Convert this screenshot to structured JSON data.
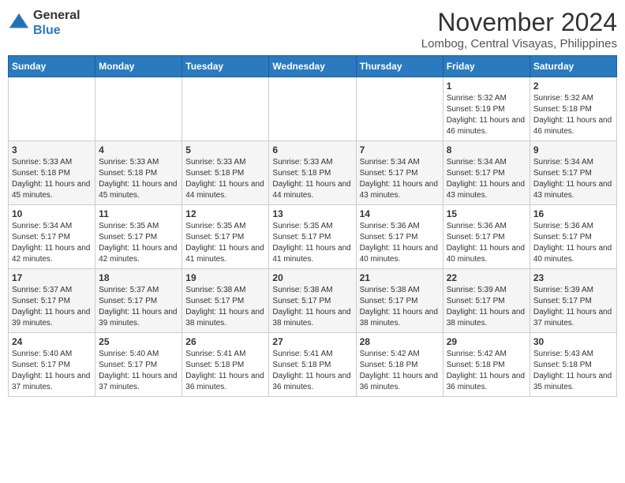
{
  "header": {
    "logo_line1": "General",
    "logo_line2": "Blue",
    "month": "November 2024",
    "location": "Lombog, Central Visayas, Philippines"
  },
  "weekdays": [
    "Sunday",
    "Monday",
    "Tuesday",
    "Wednesday",
    "Thursday",
    "Friday",
    "Saturday"
  ],
  "weeks": [
    [
      {
        "day": "",
        "info": ""
      },
      {
        "day": "",
        "info": ""
      },
      {
        "day": "",
        "info": ""
      },
      {
        "day": "",
        "info": ""
      },
      {
        "day": "",
        "info": ""
      },
      {
        "day": "1",
        "info": "Sunrise: 5:32 AM\nSunset: 5:19 PM\nDaylight: 11 hours and 46 minutes."
      },
      {
        "day": "2",
        "info": "Sunrise: 5:32 AM\nSunset: 5:18 PM\nDaylight: 11 hours and 46 minutes."
      }
    ],
    [
      {
        "day": "3",
        "info": "Sunrise: 5:33 AM\nSunset: 5:18 PM\nDaylight: 11 hours and 45 minutes."
      },
      {
        "day": "4",
        "info": "Sunrise: 5:33 AM\nSunset: 5:18 PM\nDaylight: 11 hours and 45 minutes."
      },
      {
        "day": "5",
        "info": "Sunrise: 5:33 AM\nSunset: 5:18 PM\nDaylight: 11 hours and 44 minutes."
      },
      {
        "day": "6",
        "info": "Sunrise: 5:33 AM\nSunset: 5:18 PM\nDaylight: 11 hours and 44 minutes."
      },
      {
        "day": "7",
        "info": "Sunrise: 5:34 AM\nSunset: 5:17 PM\nDaylight: 11 hours and 43 minutes."
      },
      {
        "day": "8",
        "info": "Sunrise: 5:34 AM\nSunset: 5:17 PM\nDaylight: 11 hours and 43 minutes."
      },
      {
        "day": "9",
        "info": "Sunrise: 5:34 AM\nSunset: 5:17 PM\nDaylight: 11 hours and 43 minutes."
      }
    ],
    [
      {
        "day": "10",
        "info": "Sunrise: 5:34 AM\nSunset: 5:17 PM\nDaylight: 11 hours and 42 minutes."
      },
      {
        "day": "11",
        "info": "Sunrise: 5:35 AM\nSunset: 5:17 PM\nDaylight: 11 hours and 42 minutes."
      },
      {
        "day": "12",
        "info": "Sunrise: 5:35 AM\nSunset: 5:17 PM\nDaylight: 11 hours and 41 minutes."
      },
      {
        "day": "13",
        "info": "Sunrise: 5:35 AM\nSunset: 5:17 PM\nDaylight: 11 hours and 41 minutes."
      },
      {
        "day": "14",
        "info": "Sunrise: 5:36 AM\nSunset: 5:17 PM\nDaylight: 11 hours and 40 minutes."
      },
      {
        "day": "15",
        "info": "Sunrise: 5:36 AM\nSunset: 5:17 PM\nDaylight: 11 hours and 40 minutes."
      },
      {
        "day": "16",
        "info": "Sunrise: 5:36 AM\nSunset: 5:17 PM\nDaylight: 11 hours and 40 minutes."
      }
    ],
    [
      {
        "day": "17",
        "info": "Sunrise: 5:37 AM\nSunset: 5:17 PM\nDaylight: 11 hours and 39 minutes."
      },
      {
        "day": "18",
        "info": "Sunrise: 5:37 AM\nSunset: 5:17 PM\nDaylight: 11 hours and 39 minutes."
      },
      {
        "day": "19",
        "info": "Sunrise: 5:38 AM\nSunset: 5:17 PM\nDaylight: 11 hours and 38 minutes."
      },
      {
        "day": "20",
        "info": "Sunrise: 5:38 AM\nSunset: 5:17 PM\nDaylight: 11 hours and 38 minutes."
      },
      {
        "day": "21",
        "info": "Sunrise: 5:38 AM\nSunset: 5:17 PM\nDaylight: 11 hours and 38 minutes."
      },
      {
        "day": "22",
        "info": "Sunrise: 5:39 AM\nSunset: 5:17 PM\nDaylight: 11 hours and 38 minutes."
      },
      {
        "day": "23",
        "info": "Sunrise: 5:39 AM\nSunset: 5:17 PM\nDaylight: 11 hours and 37 minutes."
      }
    ],
    [
      {
        "day": "24",
        "info": "Sunrise: 5:40 AM\nSunset: 5:17 PM\nDaylight: 11 hours and 37 minutes."
      },
      {
        "day": "25",
        "info": "Sunrise: 5:40 AM\nSunset: 5:17 PM\nDaylight: 11 hours and 37 minutes."
      },
      {
        "day": "26",
        "info": "Sunrise: 5:41 AM\nSunset: 5:18 PM\nDaylight: 11 hours and 36 minutes."
      },
      {
        "day": "27",
        "info": "Sunrise: 5:41 AM\nSunset: 5:18 PM\nDaylight: 11 hours and 36 minutes."
      },
      {
        "day": "28",
        "info": "Sunrise: 5:42 AM\nSunset: 5:18 PM\nDaylight: 11 hours and 36 minutes."
      },
      {
        "day": "29",
        "info": "Sunrise: 5:42 AM\nSunset: 5:18 PM\nDaylight: 11 hours and 36 minutes."
      },
      {
        "day": "30",
        "info": "Sunrise: 5:43 AM\nSunset: 5:18 PM\nDaylight: 11 hours and 35 minutes."
      }
    ]
  ]
}
